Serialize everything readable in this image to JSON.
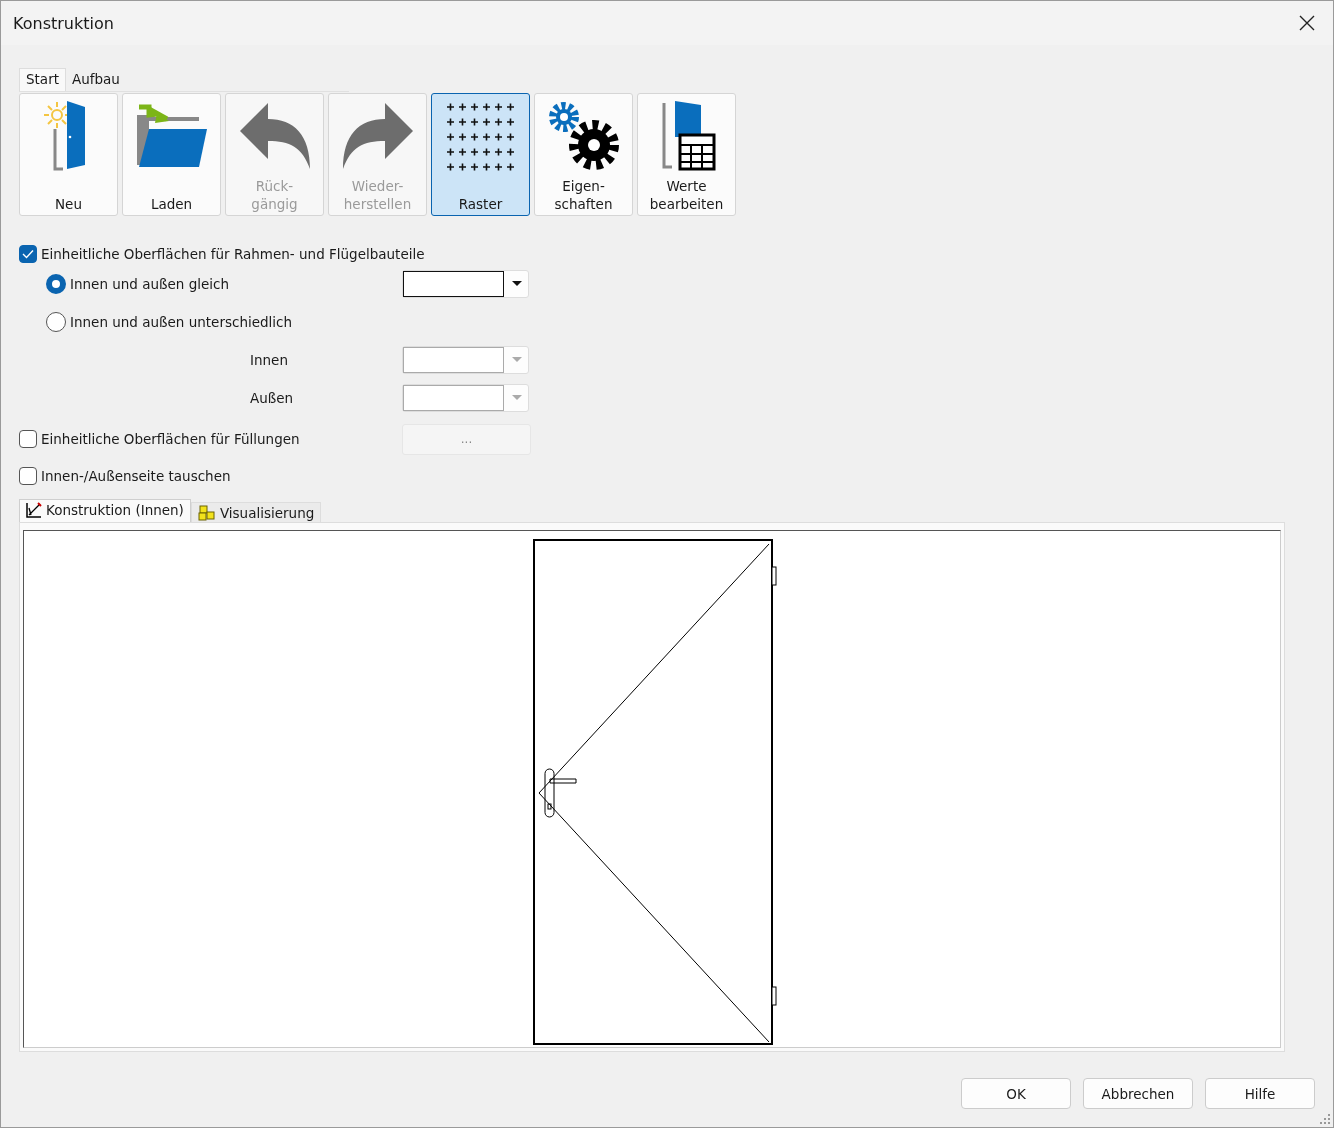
{
  "window": {
    "title": "Konstruktion"
  },
  "ribbon_tabs": [
    {
      "label": "Start",
      "selected": true
    },
    {
      "label": "Aufbau",
      "selected": false
    }
  ],
  "toolbar": [
    {
      "kind": "new",
      "lines": [
        "Neu"
      ],
      "disabled": false,
      "selected": false
    },
    {
      "kind": "open",
      "lines": [
        "Laden"
      ],
      "disabled": false,
      "selected": false
    },
    {
      "kind": "undo",
      "lines": [
        "Rück-",
        "gängig"
      ],
      "disabled": true,
      "selected": false
    },
    {
      "kind": "redo",
      "lines": [
        "Wieder-",
        "herstellen"
      ],
      "disabled": true,
      "selected": false
    },
    {
      "kind": "grid",
      "lines": [
        "Raster"
      ],
      "disabled": false,
      "selected": true
    },
    {
      "kind": "settings",
      "lines": [
        "Eigen-",
        "schaften"
      ],
      "disabled": false,
      "selected": false
    },
    {
      "kind": "table",
      "lines": [
        "Werte",
        "bearbeiten"
      ],
      "disabled": false,
      "selected": false
    }
  ],
  "uniform_frame": {
    "label": "Einheitliche Oberflächen für Rahmen- und Flügelbauteile",
    "checked": true
  },
  "radios": [
    {
      "label": "Innen und außen gleich",
      "selected": true
    },
    {
      "label": "Innen und außen unterschiedlich",
      "selected": false
    }
  ],
  "side_fields": [
    {
      "label": "Innen",
      "disabled": true
    },
    {
      "label": "Außen",
      "disabled": true
    }
  ],
  "uniform_fill": {
    "label": "Einheitliche Oberflächen für Füllungen",
    "checked": false,
    "button": "..."
  },
  "swap": {
    "label": "Innen-/Außenseite tauschen",
    "checked": false
  },
  "view_tabs": [
    {
      "kind": "construction",
      "label": "Konstruktion (Innen)",
      "selected": true
    },
    {
      "kind": "visual",
      "label": "Visualisierung",
      "selected": false
    }
  ],
  "buttons": [
    "OK",
    "Abbrechen",
    "Hilfe"
  ]
}
